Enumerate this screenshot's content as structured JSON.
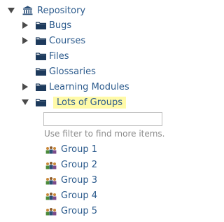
{
  "tree": {
    "root": {
      "label": "Repository",
      "icon": "repository-icon",
      "expanded": true
    },
    "items": [
      {
        "label": "Bugs",
        "icon": "folder-icon",
        "expandable": true,
        "expanded": false
      },
      {
        "label": "Courses",
        "icon": "folder-icon",
        "expandable": true,
        "expanded": false
      },
      {
        "label": "Files",
        "icon": "folder-icon",
        "expandable": false
      },
      {
        "label": "Glossaries",
        "icon": "folder-icon",
        "expandable": false
      },
      {
        "label": "Learning Modules",
        "icon": "folder-icon",
        "expandable": true,
        "expanded": false
      },
      {
        "label": "Lots of Groups",
        "icon": "folder-icon",
        "expandable": true,
        "expanded": true,
        "highlighted": true
      }
    ],
    "filter": {
      "value": "",
      "placeholder": "",
      "hint": "Use filter to find more items."
    },
    "groups": [
      {
        "label": "Group 1",
        "icon": "group-icon"
      },
      {
        "label": "Group 2",
        "icon": "group-icon"
      },
      {
        "label": "Group 3",
        "icon": "group-icon"
      },
      {
        "label": "Group 4",
        "icon": "group-icon"
      },
      {
        "label": "Group 5",
        "icon": "group-icon"
      }
    ]
  },
  "colors": {
    "link": "#2b5a8c",
    "highlight": "#fffaa8",
    "hint": "#8a8a8a",
    "toggle": "#4a4a4a"
  }
}
